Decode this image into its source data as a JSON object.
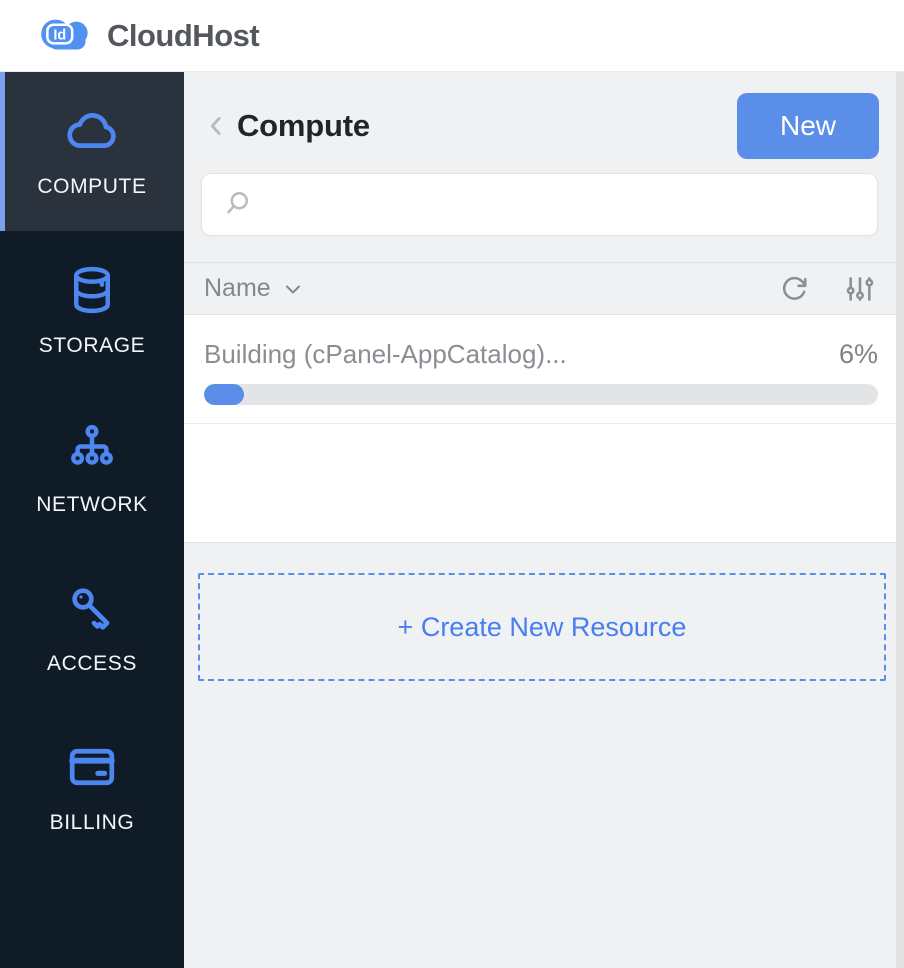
{
  "brand": {
    "badge_label": "Id",
    "name": "CloudHost"
  },
  "colors": {
    "accent_blue": "#5b8ee9",
    "icon_blue": "#4d86f0",
    "sidebar_bg": "#0f1b26",
    "sidebar_active_bg": "#29323d",
    "sidebar_active_border": "#7aa0ee",
    "page_bg": "#f0f1f2",
    "gray_text": "#84888e"
  },
  "sidebar": {
    "items": [
      {
        "label": "COMPUTE",
        "icon": "cloud-icon",
        "active": true
      },
      {
        "label": "STORAGE",
        "icon": "database-icon",
        "active": false
      },
      {
        "label": "NETWORK",
        "icon": "network-icon",
        "active": false
      },
      {
        "label": "ACCESS",
        "icon": "key-icon",
        "active": false
      },
      {
        "label": "BILLING",
        "icon": "credit-card-icon",
        "active": false
      }
    ]
  },
  "main": {
    "title": "Compute",
    "new_button_label": "New",
    "search": {
      "value": "",
      "placeholder": ""
    },
    "list_header": {
      "sort_label": "Name"
    },
    "rows": [
      {
        "name": "Building (cPanel-AppCatalog)...",
        "progress_text": "6%",
        "progress_percent": 6
      }
    ],
    "create_button_label": "+ Create New Resource"
  }
}
